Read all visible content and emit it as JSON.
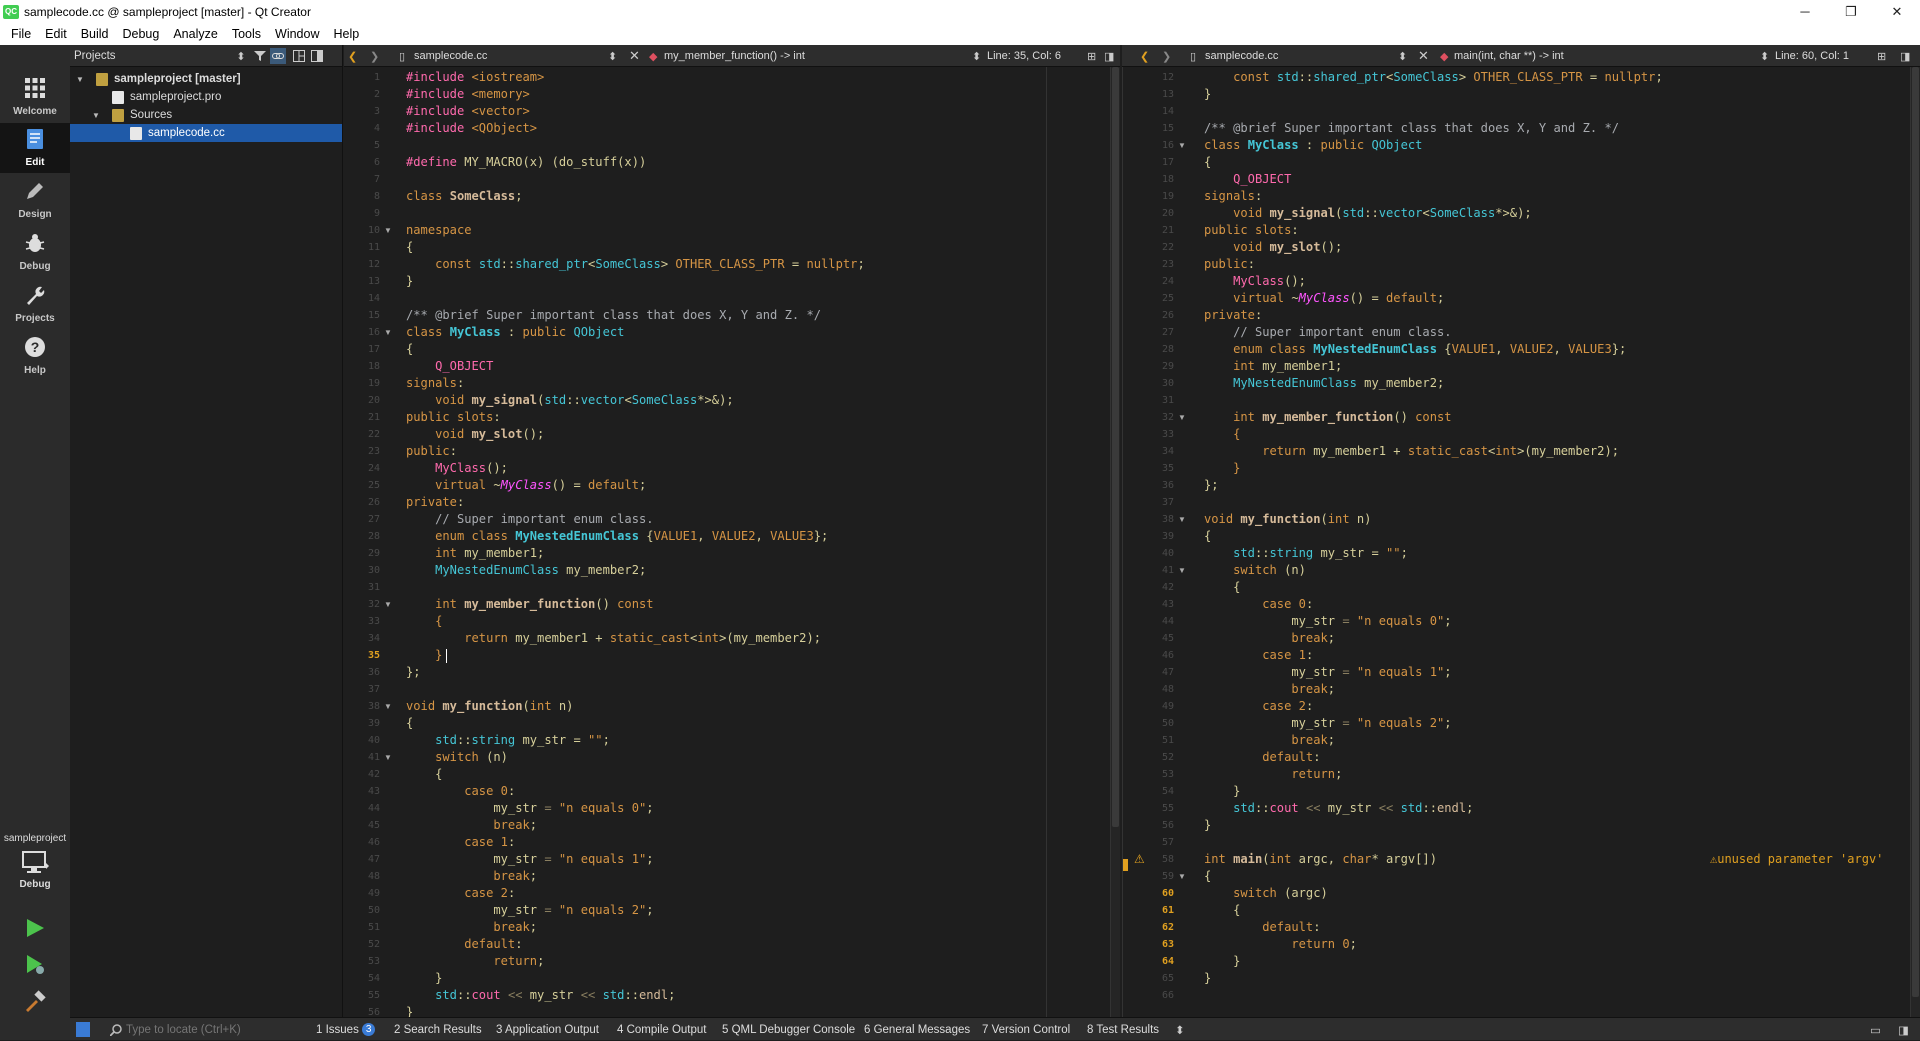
{
  "window": {
    "title": "samplecode.cc @ sampleproject [master] - Qt Creator",
    "logo": "QC",
    "minimize": "─",
    "maximize": "❐",
    "close": "✕"
  },
  "menu": [
    "File",
    "Edit",
    "Build",
    "Debug",
    "Analyze",
    "Tools",
    "Window",
    "Help"
  ],
  "modes": [
    {
      "label": "Welcome",
      "icon": "grid-icon"
    },
    {
      "label": "Edit",
      "icon": "edit-icon"
    },
    {
      "label": "Design",
      "icon": "pencil-icon"
    },
    {
      "label": "Debug",
      "icon": "bug-icon"
    },
    {
      "label": "Projects",
      "icon": "wrench-icon"
    },
    {
      "label": "Help",
      "icon": "help-icon"
    }
  ],
  "kit": {
    "project": "sampleproject",
    "mode": "Debug"
  },
  "projects_panel": {
    "selector": "Projects",
    "tree": [
      {
        "label": "sampleproject [master]",
        "level": 0,
        "expanded": true
      },
      {
        "label": "sampleproject.pro",
        "level": 1
      },
      {
        "label": "Sources",
        "level": 1,
        "expanded": true
      },
      {
        "label": "samplecode.cc",
        "level": 2,
        "selected": true
      }
    ]
  },
  "left_editor": {
    "file": "samplecode.cc",
    "symbol": "my_member_function() -> int",
    "position": "Line: 35, Col: 6",
    "current_line": 35,
    "first_line": 1
  },
  "right_editor": {
    "file": "samplecode.cc",
    "symbol": "main(int, char **) -> int",
    "position": "Line: 60, Col: 1",
    "first_line": 12,
    "warning": "unused parameter 'argv'"
  },
  "source": [
    [
      [
        "pp",
        "#include "
      ],
      [
        "s",
        "<iostream>"
      ]
    ],
    [
      [
        "pp",
        "#include "
      ],
      [
        "s",
        "<memory>"
      ]
    ],
    [
      [
        "pp",
        "#include "
      ],
      [
        "s",
        "<vector>"
      ]
    ],
    [
      [
        "pp",
        "#include "
      ],
      [
        "s",
        "<QObject>"
      ]
    ],
    [],
    [
      [
        "pp",
        "#define "
      ],
      [
        "v",
        "MY_MACRO(x) (do_stuff(x))"
      ]
    ],
    [],
    [
      [
        "k",
        "class "
      ],
      [
        "f",
        "SomeClass"
      ],
      [
        "v",
        ";"
      ]
    ],
    [],
    [
      [
        "k",
        "namespace"
      ]
    ],
    [
      [
        "v",
        "{"
      ]
    ],
    [
      [
        "v",
        "    "
      ],
      [
        "k",
        "const "
      ],
      [
        "t",
        "std"
      ],
      [
        "v",
        "::"
      ],
      [
        "t",
        "shared_ptr"
      ],
      [
        "v",
        "<"
      ],
      [
        "t",
        "SomeClass"
      ],
      [
        "v",
        "> "
      ],
      [
        "s",
        "OTHER_CLASS_PTR"
      ],
      [
        "v",
        " = "
      ],
      [
        "k",
        "nullptr"
      ],
      [
        "v",
        ";"
      ]
    ],
    [
      [
        "v",
        "}"
      ]
    ],
    [],
    [
      [
        "c",
        "/** @brief Super important class that does X, Y and Z. */"
      ]
    ],
    [
      [
        "k",
        "class "
      ],
      [
        "tf",
        "MyClass"
      ],
      [
        "v",
        " : "
      ],
      [
        "k",
        "public "
      ],
      [
        "t",
        "QObject"
      ]
    ],
    [
      [
        "v",
        "{"
      ]
    ],
    [
      [
        "v",
        "    "
      ],
      [
        "p",
        "Q_OBJECT"
      ]
    ],
    [
      [
        "k",
        "signals"
      ],
      [
        "v",
        ":"
      ]
    ],
    [
      [
        "v",
        "    "
      ],
      [
        "k",
        "void "
      ],
      [
        "f",
        "my_signal"
      ],
      [
        "v",
        "("
      ],
      [
        "t",
        "std"
      ],
      [
        "v",
        "::"
      ],
      [
        "t",
        "vector"
      ],
      [
        "v",
        "<"
      ],
      [
        "t",
        "SomeClass"
      ],
      [
        "v",
        "*>&);"
      ]
    ],
    [
      [
        "k",
        "public slots"
      ],
      [
        "v",
        ":"
      ]
    ],
    [
      [
        "v",
        "    "
      ],
      [
        "k",
        "void "
      ],
      [
        "f",
        "my_slot"
      ],
      [
        "v",
        "();"
      ]
    ],
    [
      [
        "k",
        "public"
      ],
      [
        "v",
        ":"
      ]
    ],
    [
      [
        "v",
        "    "
      ],
      [
        "p",
        "MyClass"
      ],
      [
        "v",
        "();"
      ]
    ],
    [
      [
        "v",
        "    "
      ],
      [
        "k",
        "virtual "
      ],
      [
        "v",
        "~"
      ],
      [
        "m",
        "MyClass"
      ],
      [
        "v",
        "() = "
      ],
      [
        "k",
        "default"
      ],
      [
        "v",
        ";"
      ]
    ],
    [
      [
        "k",
        "private"
      ],
      [
        "v",
        ":"
      ]
    ],
    [
      [
        "v",
        "    "
      ],
      [
        "c",
        "// Super important enum class."
      ]
    ],
    [
      [
        "v",
        "    "
      ],
      [
        "k",
        "enum class "
      ],
      [
        "tf",
        "MyNestedEnumClass"
      ],
      [
        "v",
        " {"
      ],
      [
        "en",
        "VALUE1"
      ],
      [
        "v",
        ", "
      ],
      [
        "en",
        "VALUE2"
      ],
      [
        "v",
        ", "
      ],
      [
        "en",
        "VALUE3"
      ],
      [
        "v",
        "};"
      ]
    ],
    [
      [
        "v",
        "    "
      ],
      [
        "k",
        "int "
      ],
      [
        "v",
        "my_member1;"
      ]
    ],
    [
      [
        "v",
        "    "
      ],
      [
        "t",
        "MyNestedEnumClass"
      ],
      [
        "v",
        " my_member2;"
      ]
    ],
    [],
    [
      [
        "v",
        "    "
      ],
      [
        "k",
        "int "
      ],
      [
        "f",
        "my_member_function"
      ],
      [
        "v",
        "() "
      ],
      [
        "k",
        "const"
      ]
    ],
    [
      [
        "v",
        "    "
      ],
      [
        "s",
        "{"
      ]
    ],
    [
      [
        "v",
        "        "
      ],
      [
        "k",
        "return "
      ],
      [
        "v",
        "my_member1 + "
      ],
      [
        "k",
        "static_cast"
      ],
      [
        "v",
        "<"
      ],
      [
        "k",
        "int"
      ],
      [
        "v",
        ">(my_member2);"
      ]
    ],
    [
      [
        "v",
        "    "
      ],
      [
        "s",
        "}"
      ]
    ],
    [
      [
        "v",
        "};"
      ]
    ],
    [],
    [
      [
        "k",
        "void "
      ],
      [
        "f",
        "my_function"
      ],
      [
        "v",
        "("
      ],
      [
        "k",
        "int "
      ],
      [
        "v",
        "n)"
      ]
    ],
    [
      [
        "v",
        "{"
      ]
    ],
    [
      [
        "v",
        "    "
      ],
      [
        "t",
        "std"
      ],
      [
        "v",
        "::"
      ],
      [
        "t",
        "string"
      ],
      [
        "v",
        " my_str = "
      ],
      [
        "s",
        "\"\""
      ],
      [
        "v",
        ";"
      ]
    ],
    [
      [
        "v",
        "    "
      ],
      [
        "k",
        "switch "
      ],
      [
        "v",
        "(n)"
      ]
    ],
    [
      [
        "v",
        "    {"
      ]
    ],
    [
      [
        "v",
        "        "
      ],
      [
        "k",
        "case "
      ],
      [
        "s",
        "0"
      ],
      [
        "v",
        ":"
      ]
    ],
    [
      [
        "v",
        "            my_str "
      ],
      [
        "n",
        "="
      ],
      [
        "v",
        " "
      ],
      [
        "s",
        "\"n equals 0\""
      ],
      [
        "v",
        ";"
      ]
    ],
    [
      [
        "v",
        "            "
      ],
      [
        "k",
        "break"
      ],
      [
        "v",
        ";"
      ]
    ],
    [
      [
        "v",
        "        "
      ],
      [
        "k",
        "case "
      ],
      [
        "s",
        "1"
      ],
      [
        "v",
        ":"
      ]
    ],
    [
      [
        "v",
        "            my_str "
      ],
      [
        "n",
        "="
      ],
      [
        "v",
        " "
      ],
      [
        "s",
        "\"n equals 1\""
      ],
      [
        "v",
        ";"
      ]
    ],
    [
      [
        "v",
        "            "
      ],
      [
        "k",
        "break"
      ],
      [
        "v",
        ";"
      ]
    ],
    [
      [
        "v",
        "        "
      ],
      [
        "k",
        "case "
      ],
      [
        "s",
        "2"
      ],
      [
        "v",
        ":"
      ]
    ],
    [
      [
        "v",
        "            my_str "
      ],
      [
        "n",
        "="
      ],
      [
        "v",
        " "
      ],
      [
        "s",
        "\"n equals 2\""
      ],
      [
        "v",
        ";"
      ]
    ],
    [
      [
        "v",
        "            "
      ],
      [
        "k",
        "break"
      ],
      [
        "v",
        ";"
      ]
    ],
    [
      [
        "v",
        "        "
      ],
      [
        "k",
        "default"
      ],
      [
        "v",
        ":"
      ]
    ],
    [
      [
        "v",
        "            "
      ],
      [
        "k",
        "return"
      ],
      [
        "v",
        ";"
      ]
    ],
    [
      [
        "v",
        "    }"
      ]
    ],
    [
      [
        "v",
        "    "
      ],
      [
        "t",
        "std"
      ],
      [
        "v",
        "::"
      ],
      [
        "p",
        "cout"
      ],
      [
        "v",
        " "
      ],
      [
        "n",
        "<<"
      ],
      [
        "v",
        " my_str "
      ],
      [
        "n",
        "<<"
      ],
      [
        "v",
        " "
      ],
      [
        "t",
        "std"
      ],
      [
        "v",
        "::"
      ],
      [
        "fn",
        "endl"
      ],
      [
        "v",
        ";"
      ]
    ],
    [
      [
        "v",
        "}"
      ]
    ],
    [],
    [
      [
        "k",
        "int "
      ],
      [
        "f",
        "main"
      ],
      [
        "v",
        "("
      ],
      [
        "k",
        "int "
      ],
      [
        "v",
        "argc, "
      ],
      [
        "k",
        "char"
      ],
      [
        "v",
        "* argv[])"
      ]
    ],
    [
      [
        "v",
        "{"
      ]
    ],
    [
      [
        "v",
        "    "
      ],
      [
        "k",
        "switch "
      ],
      [
        "v",
        "(argc)"
      ]
    ],
    [
      [
        "v",
        "    {"
      ]
    ],
    [
      [
        "v",
        "        "
      ],
      [
        "k",
        "default"
      ],
      [
        "v",
        ":"
      ]
    ],
    [
      [
        "v",
        "            "
      ],
      [
        "k",
        "return "
      ],
      [
        "s",
        "0"
      ],
      [
        "v",
        ";"
      ]
    ],
    [
      [
        "v",
        "    }"
      ]
    ],
    [
      [
        "v",
        "}"
      ]
    ],
    []
  ],
  "folds": [
    10,
    16,
    32,
    38,
    41,
    59
  ],
  "status": {
    "locator_placeholder": "Type to locate (Ctrl+K)",
    "tabs": [
      {
        "label": "1  Issues",
        "badge": "3"
      },
      {
        "label": "2  Search Results"
      },
      {
        "label": "3  Application Output"
      },
      {
        "label": "4  Compile Output"
      },
      {
        "label": "5  QML Debugger Console"
      },
      {
        "label": "6  General Messages"
      },
      {
        "label": "7  Version Control"
      },
      {
        "label": "8  Test Results"
      }
    ]
  }
}
